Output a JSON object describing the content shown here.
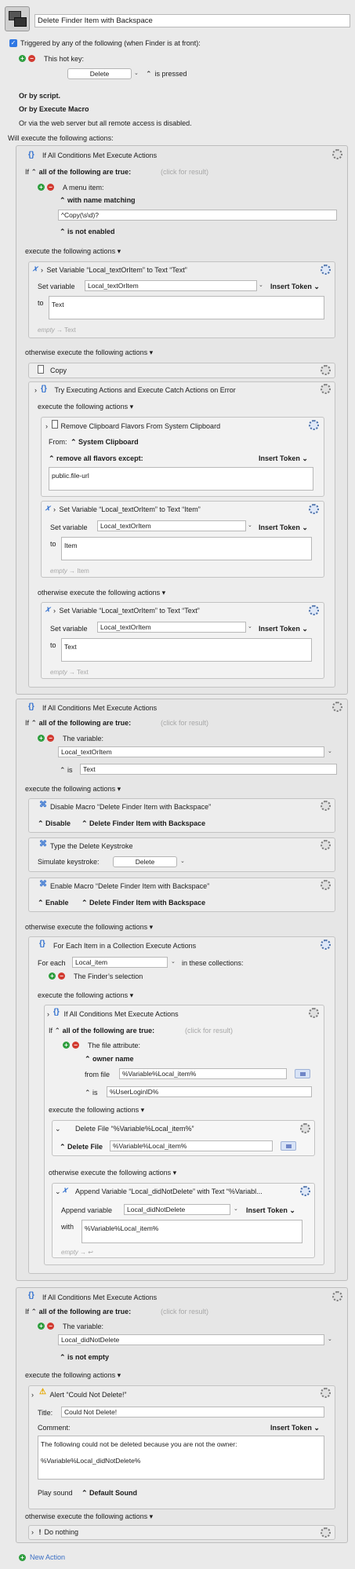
{
  "macro": {
    "title": "Delete Finder Item with Backspace",
    "trigger_label": "Triggered by any of the following (when Finder is at front):",
    "hotkey_label": "This hot key:",
    "hotkey_value": "Delete",
    "hotkey_pressed": "is pressed",
    "or_script": "Or by script.",
    "or_execute": "Or by Execute Macro",
    "web_server": "Or via the web server but all remote access is disabled.",
    "will_execute": "Will execute the following actions:"
  },
  "common": {
    "if_all": "If",
    "all_of": "all of the following are true:",
    "click_result": "(click for result)",
    "execute": "execute the following actions",
    "otherwise": "otherwise execute the following actions",
    "set_variable": "Set variable",
    "to": "to",
    "insert_token": "Insert Token",
    "empty_arrow": "empty",
    "enable": "Enable",
    "disable": "Disable",
    "with": "with"
  },
  "if1": {
    "title": "If All Conditions Met Execute Actions",
    "cond_title": "A menu item:",
    "with_name": "with name matching",
    "pattern": "^Copy(\\s\\d)?",
    "not_enabled": "is not enabled",
    "set1": {
      "title": "Set Variable “Local_textOrItem” to Text “Text”",
      "var": "Local_textOrItem",
      "value": "Text",
      "hint": "Text"
    },
    "copy": "Copy",
    "try": {
      "title": "Try Executing Actions and Execute Catch Actions on Error",
      "remove": {
        "title": "Remove Clipboard Flavors From System Clipboard",
        "from": "From:",
        "clipboard": "System Clipboard",
        "except": "remove all flavors except:",
        "value": "public.file-url"
      },
      "set_item": {
        "title": "Set Variable “Local_textOrItem” to Text “Item”",
        "var": "Local_textOrItem",
        "value": "Item",
        "hint": "Item"
      },
      "set_text": {
        "title": "Set Variable “Local_textOrItem” to Text “Text”",
        "var": "Local_textOrItem",
        "value": "Text",
        "hint": "Text"
      }
    }
  },
  "if2": {
    "title": "If All Conditions Met Execute Actions",
    "cond_title": "The variable:",
    "var": "Local_textOrItem",
    "is": "is",
    "value": "Text",
    "disable": {
      "title": "Disable Macro “Delete Finder Item with Backspace”",
      "target": "Delete Finder Item with Backspace"
    },
    "type": {
      "title": "Type the Delete Keystroke",
      "label": "Simulate keystroke:",
      "key": "Delete"
    },
    "enable": {
      "title": "Enable Macro “Delete Finder Item with Backspace”",
      "target": "Delete Finder Item with Backspace"
    },
    "foreach": {
      "title": "For Each Item in a Collection Execute Actions",
      "for_each": "For each",
      "var": "Local_item",
      "in_collections": "in these collections:",
      "selection": "The Finder’s selection",
      "if3": {
        "title": "If All Conditions Met Execute Actions",
        "cond_title": "The file attribute:",
        "owner": "owner name",
        "from_file": "from file",
        "file_value": "%Variable%Local_item%",
        "is": "is",
        "is_value": "%UserLoginID%",
        "delete": {
          "title": "Delete File “%Variable%Local_item%”",
          "label": "Delete File",
          "value": "%Variable%Local_item%"
        },
        "append": {
          "title": "Append Variable “Local_didNotDelete” with Text “%Variabl...",
          "label": "Append variable",
          "var": "Local_didNotDelete",
          "with_value": "%Variable%Local_item%"
        }
      }
    }
  },
  "if4": {
    "title": "If All Conditions Met Execute Actions",
    "cond_title": "The variable:",
    "var": "Local_didNotDelete",
    "not_empty": "is not empty",
    "alert": {
      "title": "Alert “Could Not Delete!”",
      "title_label": "Title:",
      "title_value": "Could Not Delete!",
      "comment_label": "Comment:",
      "comment_line1": "The following could not be deleted because you are not the owner:",
      "comment_line2": "%Variable%Local_didNotDelete%",
      "play_sound": "Play sound",
      "sound": "Default Sound"
    },
    "do_nothing": "Do nothing"
  },
  "new_action": "New Action"
}
